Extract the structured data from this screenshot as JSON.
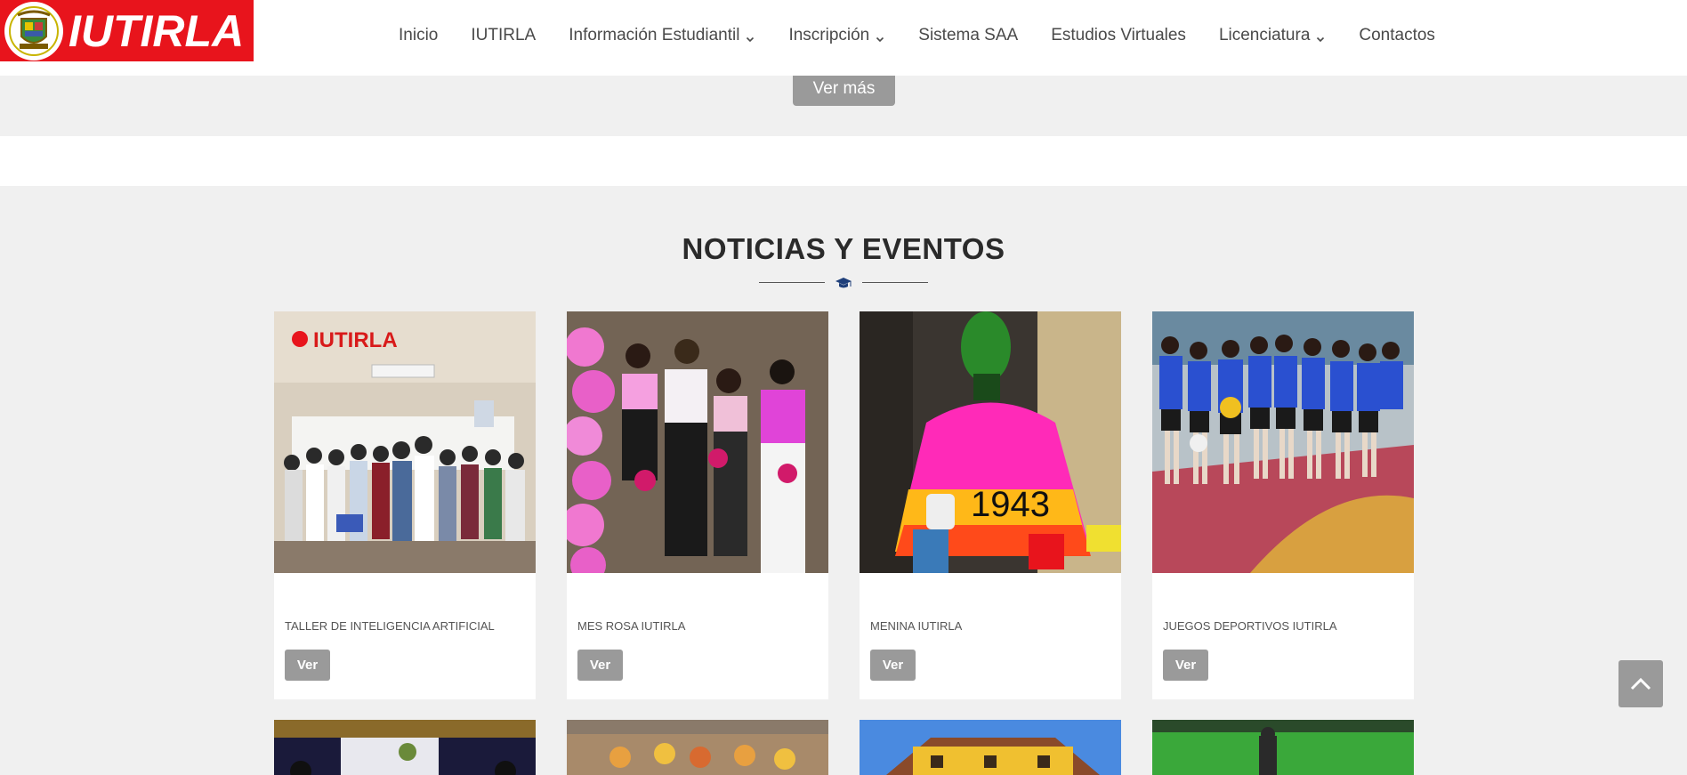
{
  "brand": {
    "name": "IUTIRLA",
    "color": "#e8141c"
  },
  "nav": {
    "items": [
      {
        "label": "Inicio",
        "dropdown": false
      },
      {
        "label": "IUTIRLA",
        "dropdown": false
      },
      {
        "label": "Información Estudiantil",
        "dropdown": true
      },
      {
        "label": "Inscripción",
        "dropdown": true
      },
      {
        "label": "Sistema SAA",
        "dropdown": false
      },
      {
        "label": "Estudios Virtuales",
        "dropdown": false
      },
      {
        "label": "Licenciatura",
        "dropdown": true
      },
      {
        "label": "Contactos",
        "dropdown": false
      }
    ]
  },
  "top": {
    "ver_mas_label": "Ver más"
  },
  "news": {
    "title": "NOTICIAS Y EVENTOS",
    "divider_icon": "graduation-cap-icon",
    "cards": [
      {
        "caption": "TALLER DE INTELIGENCIA ARTIFICIAL",
        "button": "Ver",
        "photo_sign": "IUTIRLA"
      },
      {
        "caption": "MES ROSA IUTIRLA",
        "button": "Ver"
      },
      {
        "caption": "MENINA IUTIRLA",
        "button": "Ver",
        "photo_text": "1943"
      },
      {
        "caption": "JUEGOS DEPORTIVOS IUTIRLA",
        "button": "Ver"
      }
    ]
  },
  "scroll_top": {
    "icon": "chevron-up-icon"
  },
  "colors": {
    "button_gray": "#9a9a9a",
    "section_bg": "#f0f0f0",
    "text_dark": "#2a2a2a"
  }
}
